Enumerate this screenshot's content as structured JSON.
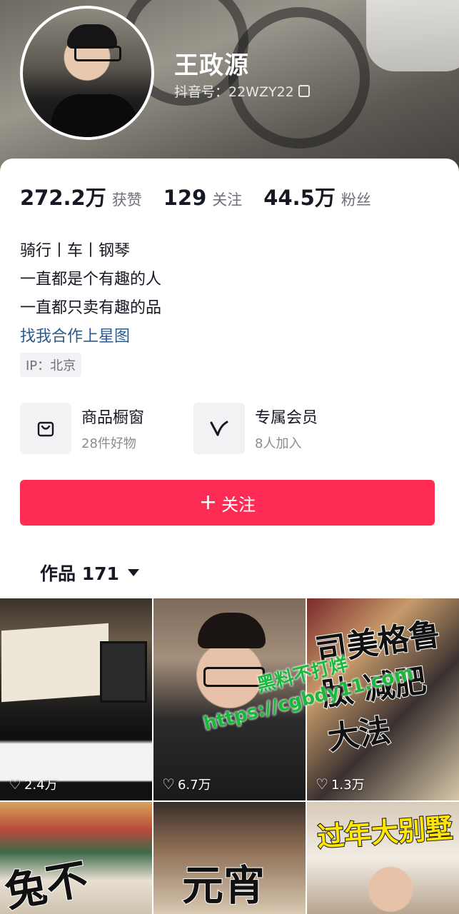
{
  "profile": {
    "name": "王政源",
    "douyin_id": "抖音号：22WZY22"
  },
  "stats": [
    {
      "value": "272.2万",
      "label": "获赞"
    },
    {
      "value": "129",
      "label": "关注"
    },
    {
      "value": "44.5万",
      "label": "粉丝"
    }
  ],
  "bio": {
    "line1": "骑行丨车丨钢琴",
    "line2": "一直都是个有趣的人",
    "line3": "一直都只卖有趣的品",
    "link": "找我合作上星图"
  },
  "ip": "IP：北京",
  "features": {
    "shop": {
      "title": "商品橱窗",
      "subtitle": "28件好物",
      "icon": "shopping-bag-icon"
    },
    "member": {
      "title": "专属会员",
      "subtitle": "8人加入",
      "icon": "v-badge-icon"
    }
  },
  "follow_button": {
    "label": "关注"
  },
  "works_tab": {
    "label": "作品 171"
  },
  "videos": [
    {
      "likes": "2.4万",
      "overlay": ""
    },
    {
      "likes": "6.7万",
      "overlay": ""
    },
    {
      "likes": "1.3万",
      "overlay": "司美格鲁肽 减肥大法"
    },
    {
      "likes": "",
      "overlay": "兔不"
    },
    {
      "likes": "",
      "overlay": "元宵"
    },
    {
      "likes": "",
      "overlay": "过年大别墅"
    }
  ],
  "watermark": {
    "line1": "黑料不打烊",
    "line2": "https://cgbdy11.com"
  },
  "colors": {
    "accent": "#fe2c55",
    "link": "#2b5a8f",
    "text": "#161823",
    "muted": "#6f7079"
  }
}
